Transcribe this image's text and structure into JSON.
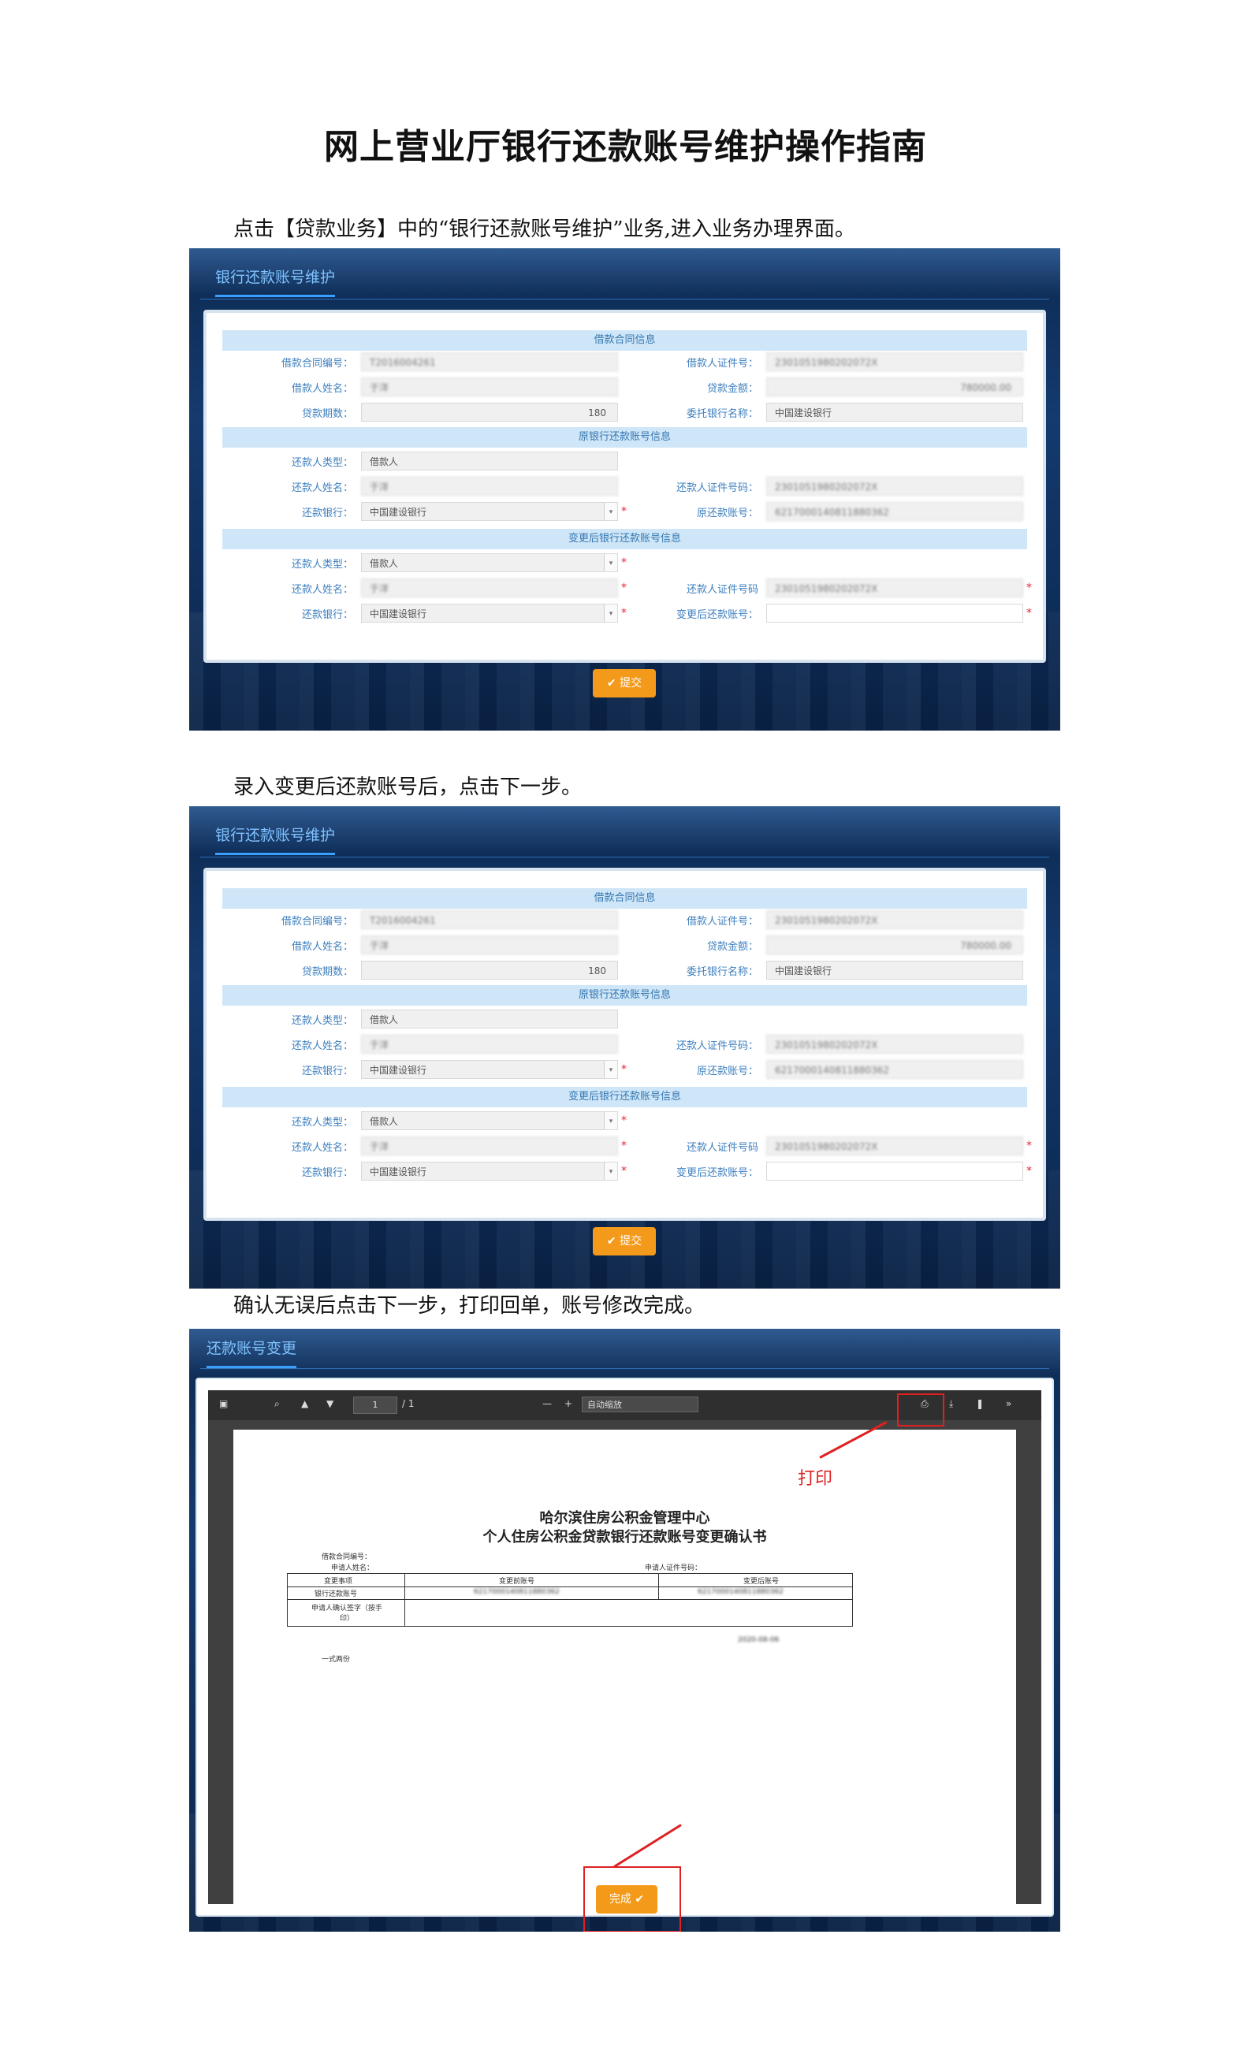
{
  "doc_title": "网上营业厅银行还款账号维护操作指南",
  "steps": [
    "点击【贷款业务】中的“银行还款账号维护”业务,进入业务办理界面。",
    "录入变更后还款账号后，点击下一步。",
    "确认无误后点击下一步，打印回单，账号修改完成。"
  ],
  "form": {
    "tab_title": "银行还款账号维护",
    "sections": [
      "借款合同信息",
      "原银行还款账号信息",
      "变更后银行还款账号信息"
    ],
    "labels": {
      "contract_no": "借款合同编号：",
      "borrower_id": "借款人证件号：",
      "borrower_name": "借款人姓名：",
      "loan_amount": "贷款金额：",
      "loan_term": "贷款期数：",
      "entrusted_bank": "委托银行名称：",
      "repayer_type": "还款人类型：",
      "repayer_name": "还款人姓名：",
      "repayer_id": "还款人证件号码：",
      "repay_bank": "还款银行：",
      "orig_account": "原还款账号：",
      "repayer_id_new": "还款人证件号码",
      "new_account": "变更后还款账号："
    },
    "values": {
      "contract_no": "T2016004261",
      "borrower_id": "2301051980202072X",
      "borrower_name": "于洋",
      "loan_amount": "780000.00",
      "loan_term": "180",
      "entrusted_bank": "中国建设银行",
      "repayer_type": "借款人",
      "repayer_name": "于洋",
      "repayer_id": "2301051980202072X",
      "repay_bank": "中国建设银行",
      "orig_account": "6217000140811880362",
      "repayer_type_new": "借款人",
      "repayer_name_new": "于洋",
      "repayer_id_new": "2301051980202072X",
      "repay_bank_new": "中国建设银行",
      "new_account": ""
    },
    "submit_label": "✔ 提交"
  },
  "confirm": {
    "tab_title": "还款账号变更",
    "page_indicator": "1",
    "page_total": "/ 1",
    "zoom": "自动缩放",
    "doc_heading_1": "哈尔滨住房公积金管理中心",
    "doc_heading_2": "个人住房公积金贷款银行还款账号变更确认书",
    "doc_rows": [
      "借款合同编号：",
      "申请人姓名：",
      "申请人证件号码：",
      "变更事项",
      "变更前账号",
      "变更后账号",
      "银行还款账号",
      "申请人确认签字（按手印）"
    ],
    "doc_date": "2020-08-06",
    "doc_copies": "一式两份",
    "print_annotation": "打印",
    "done_label": "完成 ✔"
  }
}
